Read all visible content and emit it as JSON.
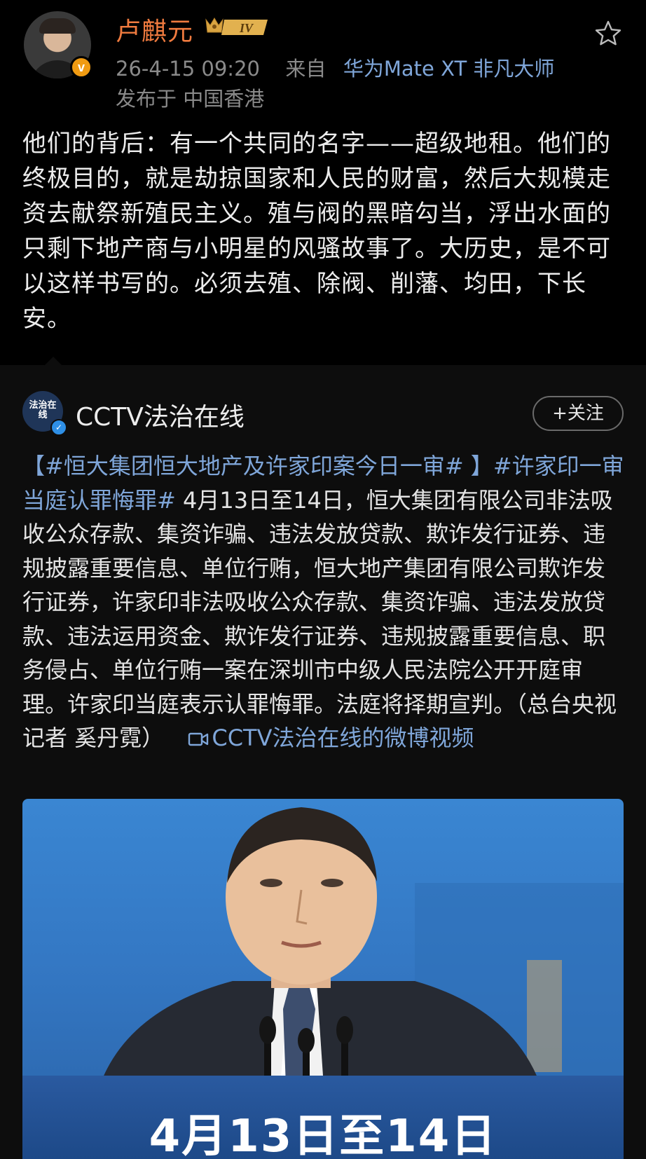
{
  "post": {
    "author": "卢麒元",
    "level_badge": "IV",
    "verified_badge": "v",
    "timestamp": "26-4-15 09:20",
    "from_label": "来自",
    "device": "华为Mate XT 非凡大师",
    "location": "发布于 中国香港",
    "text": "他们的背后：有一个共同的名字——超级地租。他们的终极目的，就是劫掠国家和人民的财富，然后大规模走资去献祭新殖民主义。殖与阀的黑暗勾当，浮出水面的只剩下地产商与小明星的风骚故事了。大历史，是不可以这样书写的。必须去殖、除阀、削藩、均田，下长安。"
  },
  "repost": {
    "source_logo_text": "法治在线",
    "source_name": "CCTV法治在线",
    "follow_label": "+关注",
    "tag1": "【#恒大集团恒大地产及许家印案今日一审# 】",
    "tag2": "#许家印一审当庭认罪悔罪#",
    "body": " 4月13日至14日，恒大集团有限公司非法吸收公众存款、集资诈骗、违法发放贷款、欺诈发行证券、违规披露重要信息、单位行贿，恒大地产集团有限公司欺诈发行证券，许家印非法吸收公众存款、集资诈骗、违法发放贷款、违法运用资金、欺诈发行证券、违规披露重要信息、职务侵占、单位行贿一案在深圳市中级人民法院公开开庭审理。许家印当庭表示认罪悔罪。法庭将择期宣判。（总台央视记者 奚丹霓）",
    "video_link": "CCTV法治在线的微博视频",
    "video_caption": "4月13日至14日"
  },
  "colors": {
    "author": "#f07b3f",
    "link": "#7fa6d9",
    "background": "#000000",
    "verified_orange": "#f09b12",
    "verified_blue": "#2e8fe6"
  },
  "icons": {
    "star": "star-outline-icon",
    "video": "video-camera-icon"
  }
}
